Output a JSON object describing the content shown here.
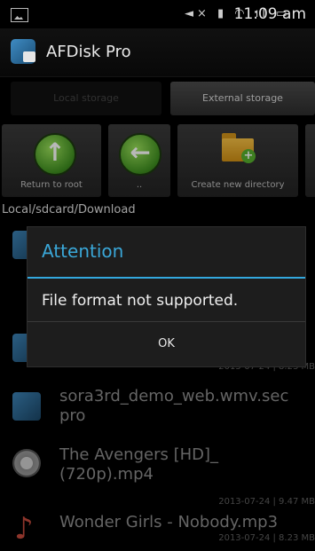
{
  "status_bar": {
    "time": "11:09 am",
    "icons": [
      "picture-icon",
      "mute-icon",
      "battery-alert-icon",
      "wifi-icon",
      "signal-icon",
      "battery-icon"
    ]
  },
  "app": {
    "title": "AFDisk Pro"
  },
  "tabs": [
    {
      "label": "Local storage",
      "active": false
    },
    {
      "label": "External storage",
      "active": true
    }
  ],
  "toolbar": {
    "return_to_root": "Return to root",
    "back": "..",
    "create_directory": "Create new directory"
  },
  "path": "Local/sdcard/Download",
  "files": [
    {
      "name": "sora3rd_demo_web.wmv.sec",
      "name2": "pro",
      "meta": "",
      "icon": "app-file-icon"
    },
    {
      "name": "The Avengers [HD]_",
      "name2": "(720p).mp4",
      "meta": "2013-07-24 | 9.47 MB",
      "icon": "film-reel-icon"
    },
    {
      "name": "Wonder Girls - Nobody.mp3",
      "name2": "",
      "meta": "2013-07-24 | 8.23 MB",
      "icon": "music-note-icon"
    }
  ],
  "partial_row_meta": "2013-07-24 | 8.23 MB",
  "dialog": {
    "title": "Attention",
    "message": "File format not supported.",
    "ok": "OK"
  },
  "colors": {
    "accent": "#33a8de",
    "button_green": "#4ea52a"
  }
}
